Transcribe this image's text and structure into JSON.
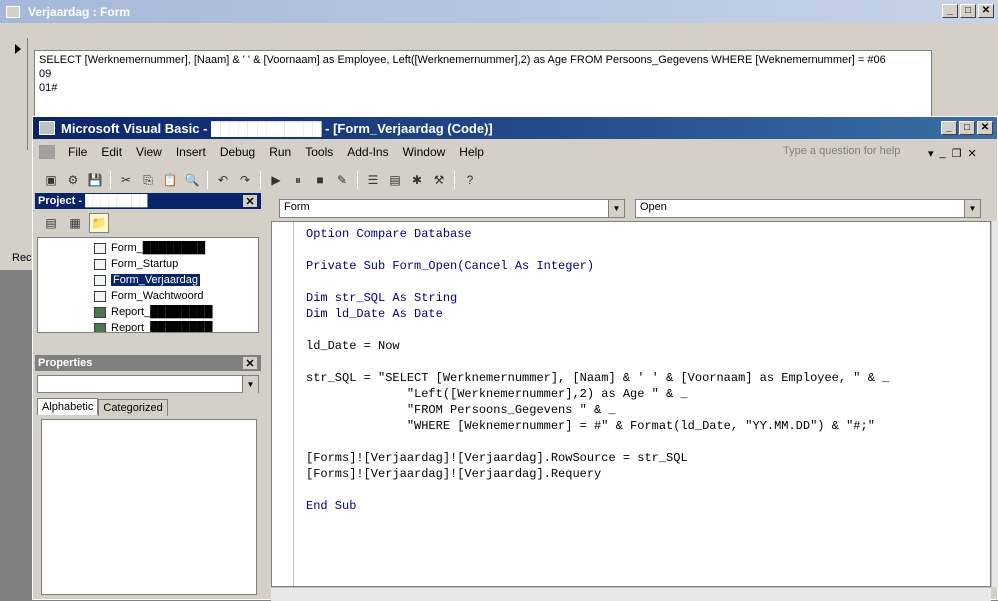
{
  "access_window": {
    "title": "Verjaardag : Form",
    "sql_text": "SELECT [Werknemernummer], [Naam] & ' ' & [Voornaam] as Employee, Left([Werknemernummer],2) as Age FROM Persoons_Gegevens WHERE [Weknemernummer] = #06\n09\n01#",
    "record_label": "Rec"
  },
  "vb_window": {
    "title": "Microsoft Visual Basic - ████████████ - [Form_Verjaardag (Code)]",
    "menu": [
      "File",
      "Edit",
      "View",
      "Insert",
      "Debug",
      "Run",
      "Tools",
      "Add-Ins",
      "Window",
      "Help"
    ],
    "ask_placeholder": "Type a question for help"
  },
  "project_panel": {
    "title": "Project - ████████",
    "items": [
      {
        "label": "Form_████████",
        "selected": false
      },
      {
        "label": "Form_Startup",
        "selected": false
      },
      {
        "label": "Form_Verjaardag",
        "selected": true
      },
      {
        "label": "Form_Wachtwoord",
        "selected": false
      },
      {
        "label": "Report_████████",
        "selected": false
      },
      {
        "label": "Report_████████",
        "selected": false
      }
    ]
  },
  "properties_panel": {
    "title": "Properties",
    "tabs": [
      "Alphabetic",
      "Categorized"
    ]
  },
  "code_editor": {
    "object_combo": "Form",
    "procedure_combo": "Open",
    "lines": [
      "Option Compare Database",
      "",
      "Private Sub Form_Open(Cancel As Integer)",
      "",
      "Dim str_SQL As String",
      "Dim ld_Date As Date",
      "",
      "ld_Date = Now",
      "",
      "str_SQL = \"SELECT [Werknemernummer], [Naam] & ' ' & [Voornaam] as Employee, \" & _",
      "              \"Left([Werknemernummer],2) as Age \" & _",
      "              \"FROM Persoons_Gegevens \" & _",
      "              \"WHERE [Weknemernummer] = #\" & Format(ld_Date, \"YY.MM.DD\") & \"#;\"",
      "",
      "[Forms]![Verjaardag]![Verjaardag].RowSource = str_SQL",
      "[Forms]![Verjaardag]![Verjaardag].Requery",
      "",
      "End Sub"
    ]
  }
}
